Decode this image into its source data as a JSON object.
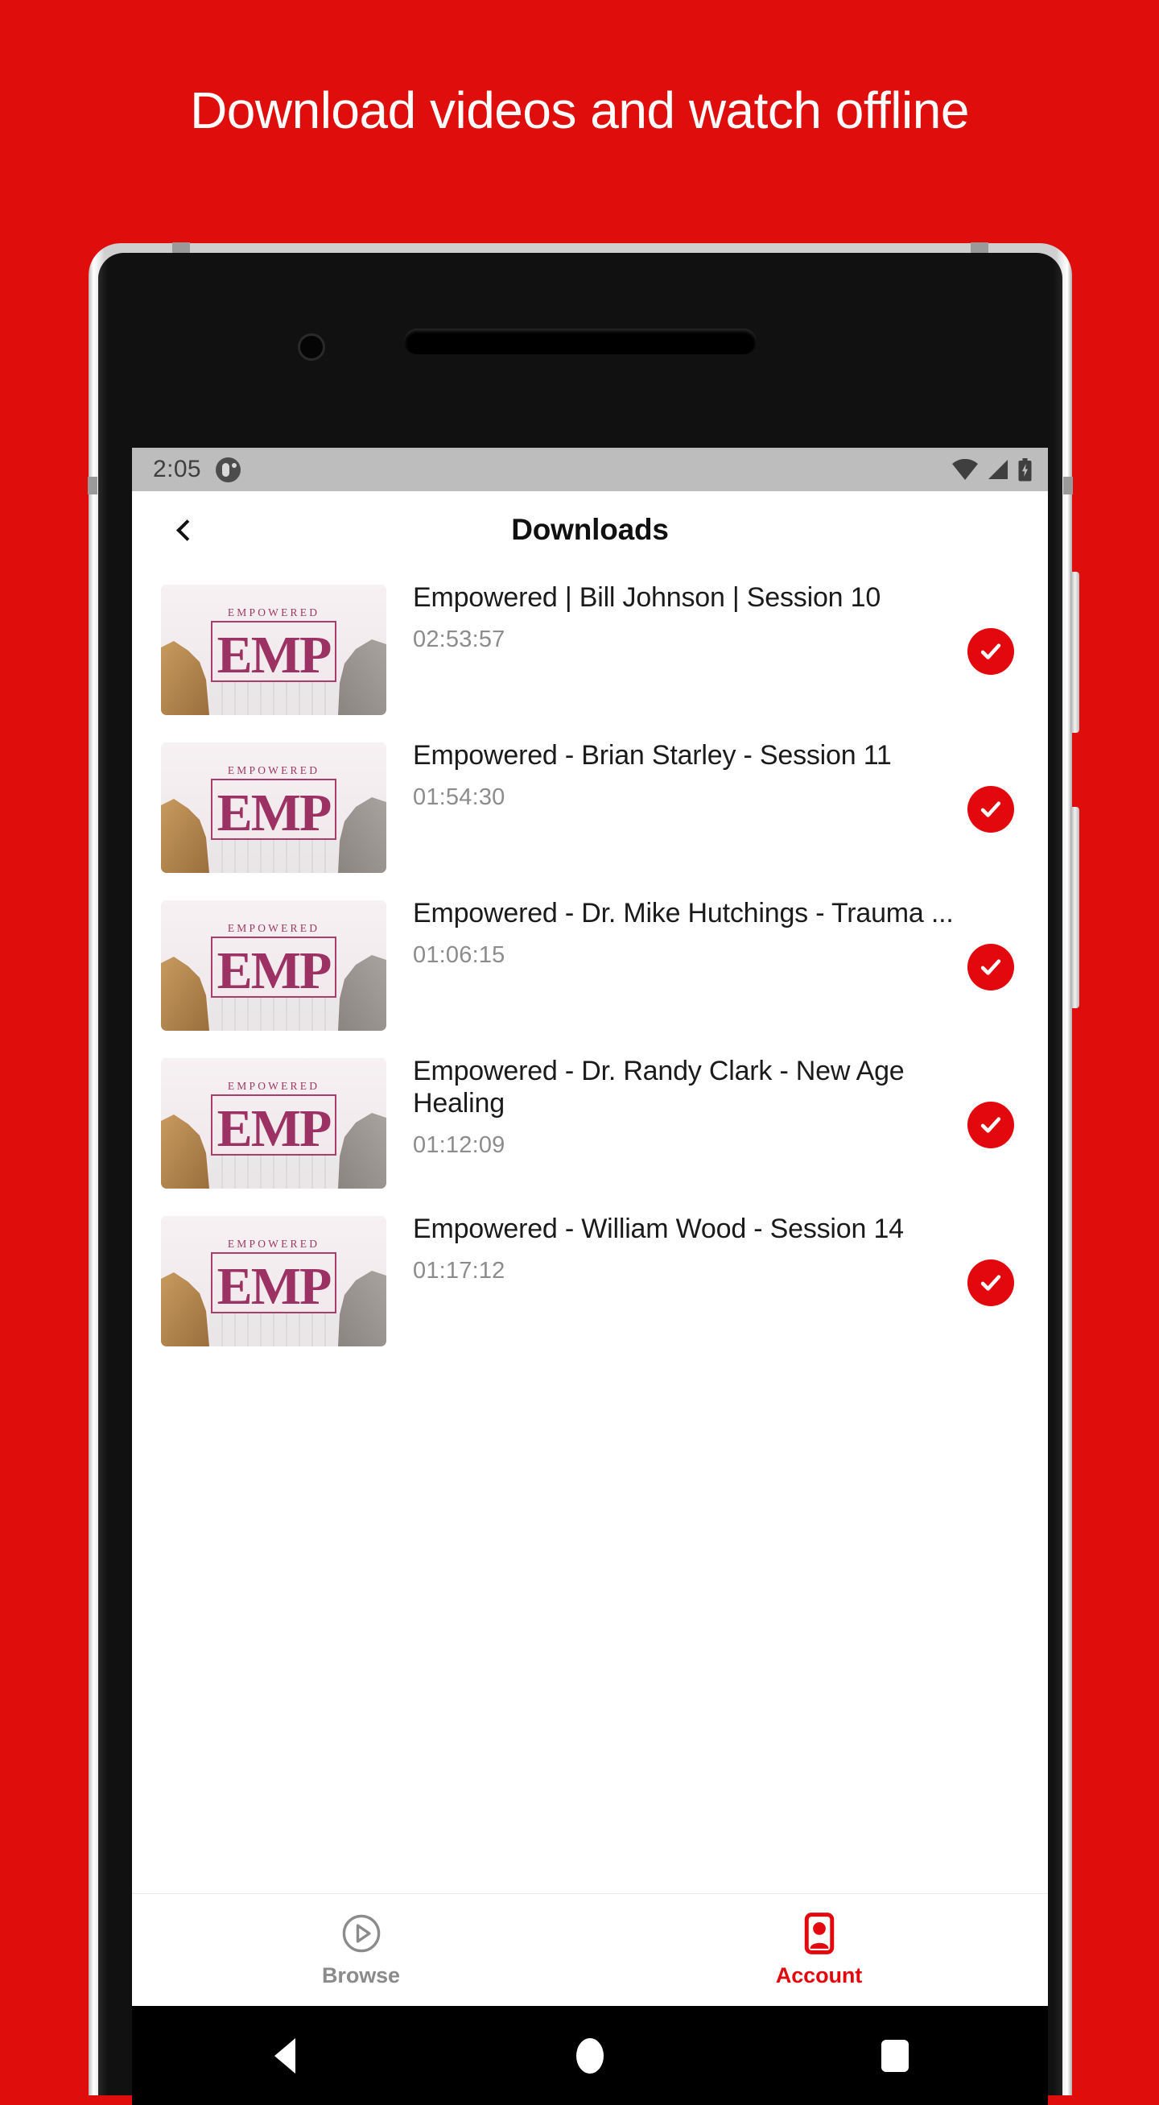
{
  "promo": {
    "headline": "Download videos and watch offline",
    "background_color": "#e00d0d"
  },
  "status_bar": {
    "time": "2:05",
    "notification_icon": "app-notification-icon",
    "icons": [
      "wifi-icon",
      "cellular-signal-icon",
      "battery-charging-icon"
    ]
  },
  "app_bar": {
    "back_label": "back-chevron-icon",
    "title": "Downloads"
  },
  "downloads": {
    "items": [
      {
        "title": "Empowered | Bill Johnson | Session 10",
        "duration": "02:53:57",
        "status": "downloaded",
        "thumbnail": {
          "kicker": "EMPOWERED",
          "monogram": "EMP"
        }
      },
      {
        "title": "Empowered - Brian Starley - Session 11",
        "duration": "01:54:30",
        "status": "downloaded",
        "thumbnail": {
          "kicker": "EMPOWERED",
          "monogram": "EMP"
        }
      },
      {
        "title": "Empowered - Dr. Mike Hutchings - Trauma ...",
        "duration": "01:06:15",
        "status": "downloaded",
        "thumbnail": {
          "kicker": "EMPOWERED",
          "monogram": "EMP"
        }
      },
      {
        "title": "Empowered - Dr. Randy Clark - New Age Healing",
        "duration": "01:12:09",
        "status": "downloaded",
        "thumbnail": {
          "kicker": "EMPOWERED",
          "monogram": "EMP"
        }
      },
      {
        "title": "Empowered - William Wood - Session 14",
        "duration": "01:17:12",
        "status": "downloaded",
        "thumbnail": {
          "kicker": "EMPOWERED",
          "monogram": "EMP"
        }
      }
    ]
  },
  "tab_bar": {
    "items": [
      {
        "label": "Browse",
        "icon": "play-circle-icon",
        "active": false,
        "color": "#8b8b8b"
      },
      {
        "label": "Account",
        "icon": "person-card-icon",
        "active": true,
        "color": "#e3080d"
      }
    ]
  },
  "android_nav": {
    "buttons": [
      "back-triangle-icon",
      "home-circle-icon",
      "recents-square-icon"
    ]
  },
  "theme": {
    "accent": "#e3080d",
    "status_bar_bg": "#bdbdbd",
    "muted_text": "#8c8c8c"
  }
}
